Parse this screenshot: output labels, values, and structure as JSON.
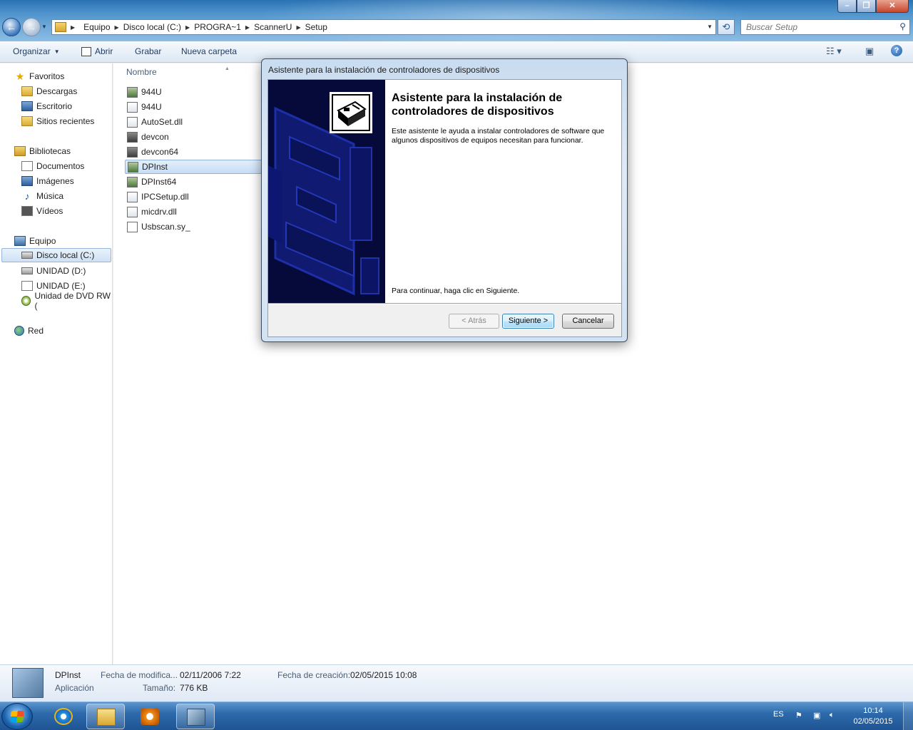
{
  "address": {
    "crumbs": [
      "Equipo",
      "Disco local (C:)",
      "PROGRA~1",
      "ScannerU",
      "Setup"
    ],
    "search_placeholder": "Buscar Setup"
  },
  "commands": {
    "organize": "Organizar",
    "open": "Abrir",
    "burn": "Grabar",
    "new_folder": "Nueva carpeta"
  },
  "nav": {
    "favorites": "Favoritos",
    "downloads": "Descargas",
    "desktop": "Escritorio",
    "recent": "Sitios recientes",
    "libraries": "Bibliotecas",
    "documents": "Documentos",
    "images": "Imágenes",
    "music": "Música",
    "videos": "Vídeos",
    "computer": "Equipo",
    "local_disk": "Disco local (C:)",
    "drive_d": "UNIDAD (D:)",
    "drive_e": "UNIDAD (E:)",
    "dvd": "Unidad de DVD RW (",
    "network": "Red"
  },
  "files": {
    "column_name": "Nombre",
    "items": [
      "944U",
      "944U",
      "AutoSet.dll",
      "devcon",
      "devcon64",
      "DPInst",
      "DPInst64",
      "IPCSetup.dll",
      "micdrv.dll",
      "Usbscan.sy_"
    ]
  },
  "details": {
    "name": "DPInst",
    "type": "Aplicación",
    "modified_label": "Fecha de modifica...",
    "modified_value": "02/11/2006 7:22",
    "size_label": "Tamaño:",
    "size_value": "776 KB",
    "created_label": "Fecha de creación:",
    "created_value": "02/05/2015 10:08"
  },
  "dialog": {
    "window_title": "Asistente para la instalación de controladores de dispositivos",
    "heading": "Asistente para la instalación de controladores de dispositivos",
    "description": "Este asistente le ayuda a instalar controladores de software que algunos dispositivos de equipos necesitan para funcionar.",
    "continue_text": "Para continuar, haga clic en Siguiente.",
    "back_button": "< Atrás",
    "next_button": "Siguiente >",
    "cancel_button": "Cancelar"
  },
  "taskbar": {
    "language": "ES",
    "time": "10:14",
    "date": "02/05/2015"
  }
}
